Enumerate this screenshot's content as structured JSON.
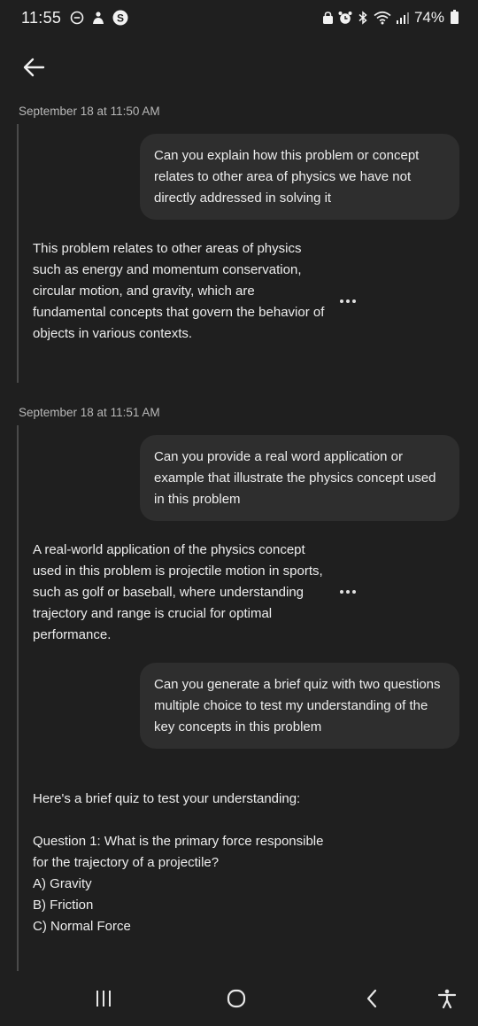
{
  "status_bar": {
    "time": "11:55",
    "battery": "74%",
    "left_icons": [
      "minus-circle-icon",
      "notification-icon",
      "s-badge-icon"
    ],
    "right_icons": [
      "lock-icon",
      "alarm-icon",
      "bluetooth-icon",
      "wifi-icon",
      "signal-icon",
      "battery-icon"
    ]
  },
  "header": {
    "back_icon": "arrow-left-icon"
  },
  "conversation": {
    "sections": [
      {
        "timestamp": "September 18 at 11:50 AM",
        "messages": [
          {
            "role": "user",
            "text": "Can you explain how this problem or concept relates to other area of physics we have not directly addressed in solving it"
          },
          {
            "role": "assistant",
            "text": "This problem relates to other areas of physics such as energy and momentum conservation, circular motion, and gravity, which are fundamental concepts that govern the behavior of objects in various contexts."
          }
        ]
      },
      {
        "timestamp": "September 18 at 11:51 AM",
        "messages": [
          {
            "role": "user",
            "text": "Can you provide a real word application or example that illustrate the physics concept used in this problem"
          },
          {
            "role": "assistant",
            "text": "A real-world application of the physics concept used in this problem is projectile motion in sports, such as golf or baseball, where understanding trajectory and range is crucial for optimal performance."
          },
          {
            "role": "user",
            "text": "Can you generate a brief quiz with two questions multiple choice to test my understanding of the key concepts in this problem"
          },
          {
            "role": "assistant",
            "text": "Here's a brief quiz to test your understanding:\n\nQuestion 1: What is the primary force responsible for the trajectory of a projectile?\nA) Gravity\nB) Friction\nC) Normal Force"
          }
        ]
      }
    ]
  },
  "nav_bar": {
    "buttons": [
      "recent-apps-icon",
      "home-icon",
      "back-chevron-icon",
      "accessibility-icon"
    ]
  },
  "colors": {
    "background": "#1f1f1f",
    "user_bubble": "#2e2e2e",
    "text": "#ececec",
    "timestamp": "#b8b8b8"
  }
}
